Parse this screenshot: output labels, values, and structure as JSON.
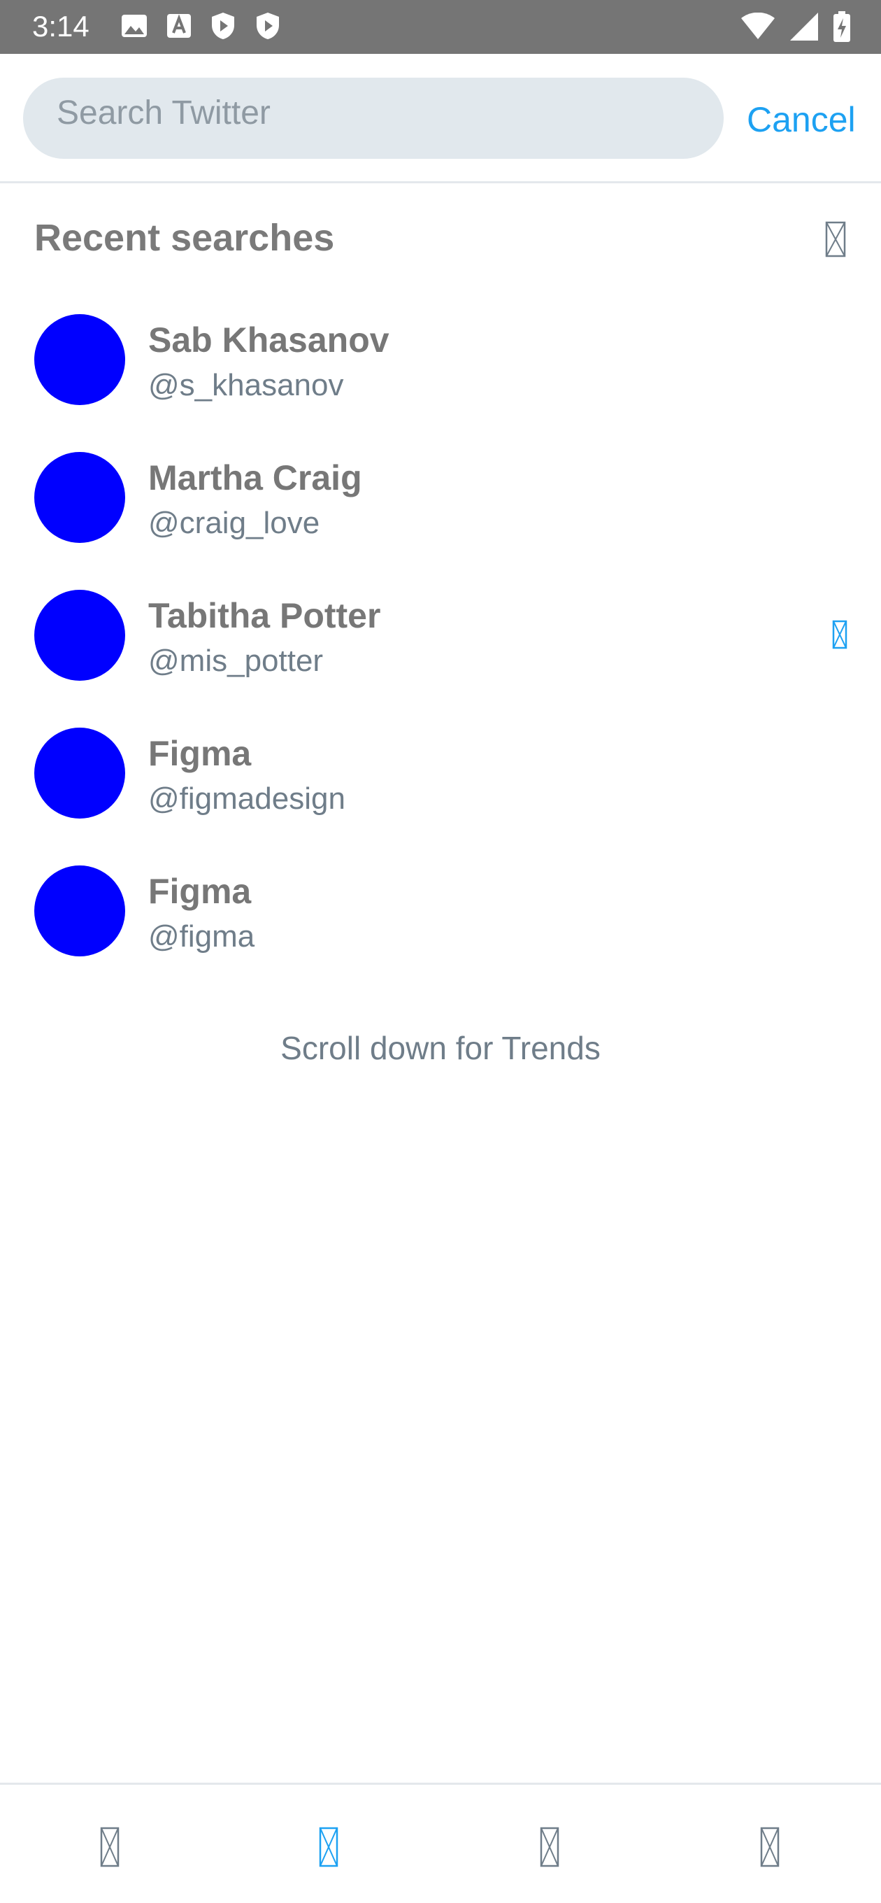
{
  "status_bar": {
    "time": "3:14",
    "left_icons": [
      "image-icon",
      "font-icon",
      "shield-play-icon",
      "shield-play-icon"
    ],
    "right_icons": [
      "wifi-icon",
      "signal-icon",
      "battery-charging-icon"
    ]
  },
  "search": {
    "placeholder": "Search Twitter",
    "value": "",
    "cancel_label": "Cancel"
  },
  "recent": {
    "title": "Recent searches",
    "items": [
      {
        "name": "Sab Khasanov",
        "handle": "@s_khasanov",
        "avatar_color": "#0000ff",
        "highlighted": false
      },
      {
        "name": "Martha Craig",
        "handle": "@craig_love",
        "avatar_color": "#0000ff",
        "highlighted": false
      },
      {
        "name": "Tabitha Potter",
        "handle": "@mis_potter",
        "avatar_color": "#0000ff",
        "highlighted": true
      },
      {
        "name": "Figma",
        "handle": "@figmadesign",
        "avatar_color": "#0000ff",
        "highlighted": false
      },
      {
        "name": "Figma",
        "handle": "@figma",
        "avatar_color": "#0000ff",
        "highlighted": false
      }
    ]
  },
  "scroll_hint": "Scroll down for Trends",
  "bottom_nav": {
    "items": [
      {
        "icon": "home-icon",
        "active": false
      },
      {
        "icon": "search-icon",
        "active": true
      },
      {
        "icon": "notifications-icon",
        "active": false
      },
      {
        "icon": "messages-icon",
        "active": false
      }
    ]
  },
  "colors": {
    "accent": "#1da1f2",
    "status_bar": "#757575",
    "search_box": "#e1e8ed",
    "avatar": "#0000ff",
    "icon_gray": "#6f7d89"
  }
}
